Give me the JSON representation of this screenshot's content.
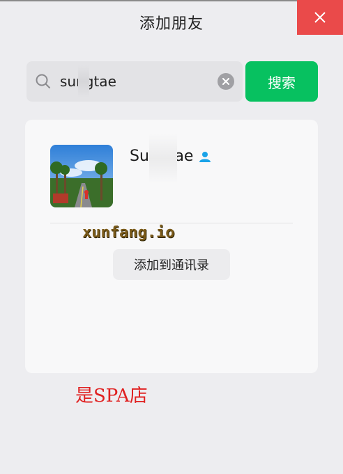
{
  "window": {
    "title": "添加朋友"
  },
  "search": {
    "value": "sungtae",
    "button_label": "搜索"
  },
  "result": {
    "name": "Sungtae"
  },
  "card": {
    "watermark": "xunfang.io",
    "add_contact_label": "添加到通讯录"
  },
  "note": {
    "text": "是SPA店"
  },
  "colors": {
    "accent": "#07c160",
    "close": "#ea4a4a",
    "contact_icon": "#1aa3e8",
    "note": "#e02020"
  },
  "icons": [
    "close-icon",
    "search-icon",
    "clear-icon",
    "contact-person-icon"
  ]
}
